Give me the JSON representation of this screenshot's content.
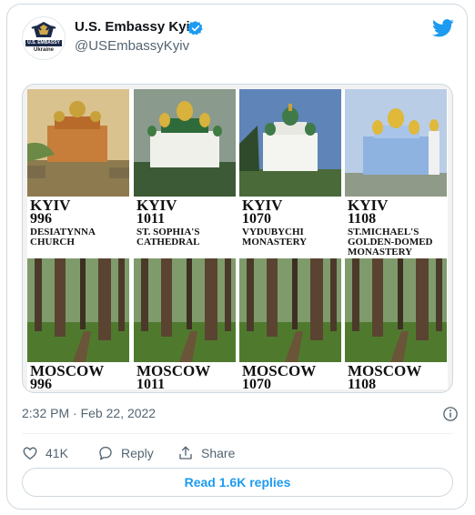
{
  "tweet": {
    "display_name": "U.S. Embassy Kyiv",
    "handle": "@USEmbassyKyiv",
    "avatar": {
      "banner": "U.S. EMBASSY",
      "sub": "Ukraine"
    },
    "verified": true,
    "timestamp": "2:32 PM · Feb 22, 2022",
    "likes": "41K",
    "reply_label": "Reply",
    "share_label": "Share",
    "read_replies": "Read 1.6K replies"
  },
  "image": {
    "kyiv": [
      {
        "city": "KYIV",
        "year": "996",
        "desc": "DESIATYNNA\nCHURCH"
      },
      {
        "city": "KYIV",
        "year": "1011",
        "desc": "ST. SOPHIA'S\nCATHEDRAL"
      },
      {
        "city": "KYIV",
        "year": "1070",
        "desc": "VYDUBYCHI\nMONASTERY"
      },
      {
        "city": "KYIV",
        "year": "1108",
        "desc": "ST.MICHAEL'S\nGOLDEN-DOMED\nMONASTERY"
      }
    ],
    "moscow": [
      {
        "city": "MOSCOW",
        "year": "996"
      },
      {
        "city": "MOSCOW",
        "year": "1011"
      },
      {
        "city": "MOSCOW",
        "year": "1070"
      },
      {
        "city": "MOSCOW",
        "year": "1108"
      }
    ]
  },
  "colors": {
    "accent": "#1d9bf0",
    "muted": "#536471",
    "border": "#cfd9de"
  },
  "icons": [
    "verified-badge-icon",
    "twitter-bird-icon",
    "info-icon",
    "heart-icon",
    "reply-icon",
    "share-icon"
  ]
}
